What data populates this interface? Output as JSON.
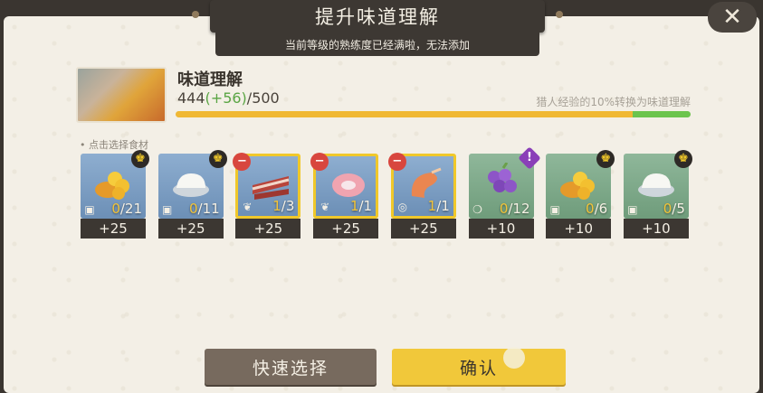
{
  "dialog": {
    "title": "提升味道理解",
    "subtitle": "当前等级的熟练度已经满啦，无法添加",
    "close_glyph": "✕"
  },
  "skill": {
    "name": "味道理解",
    "current": "444",
    "gain": "(+56)",
    "max": "/500",
    "note": "猎人经验的10%转换为味道理解",
    "current_fraction": 0.888,
    "gain_fraction": 0.112
  },
  "select_label": "• 点击选择食材",
  "items": [
    {
      "name": "golden-coins",
      "have": "0",
      "total": "/21",
      "exp": "+25",
      "bg": "blue",
      "badge": "type",
      "small": "milk"
    },
    {
      "name": "cream",
      "have": "0",
      "total": "/11",
      "exp": "+25",
      "bg": "blue",
      "badge": "type",
      "small": "milk"
    },
    {
      "name": "bacon",
      "have": "1",
      "total": "/3",
      "exp": "+25",
      "bg": "sel",
      "badge": "minus",
      "small": "meat"
    },
    {
      "name": "meat-slice",
      "have": "1",
      "total": "/1",
      "exp": "+25",
      "bg": "sel",
      "badge": "minus",
      "small": "meat"
    },
    {
      "name": "shrimp",
      "have": "1",
      "total": "/1",
      "exp": "+25",
      "bg": "sel",
      "badge": "minus",
      "small": "fish"
    },
    {
      "name": "purple-berries",
      "have": "0",
      "total": "/12",
      "exp": "+10",
      "bg": "green",
      "badge": "rare",
      "small": "fruit"
    },
    {
      "name": "golden-coins",
      "have": "0",
      "total": "/6",
      "exp": "+10",
      "bg": "green",
      "badge": "type",
      "small": "milk"
    },
    {
      "name": "cream",
      "have": "0",
      "total": "/5",
      "exp": "+10",
      "bg": "green",
      "badge": "type",
      "small": "milk"
    }
  ],
  "buttons": {
    "quick_select": "快速选择",
    "confirm": "确认"
  },
  "colors": {
    "accent": "#f1c83a",
    "gain": "#6cc44d",
    "dark": "#3d3833"
  }
}
